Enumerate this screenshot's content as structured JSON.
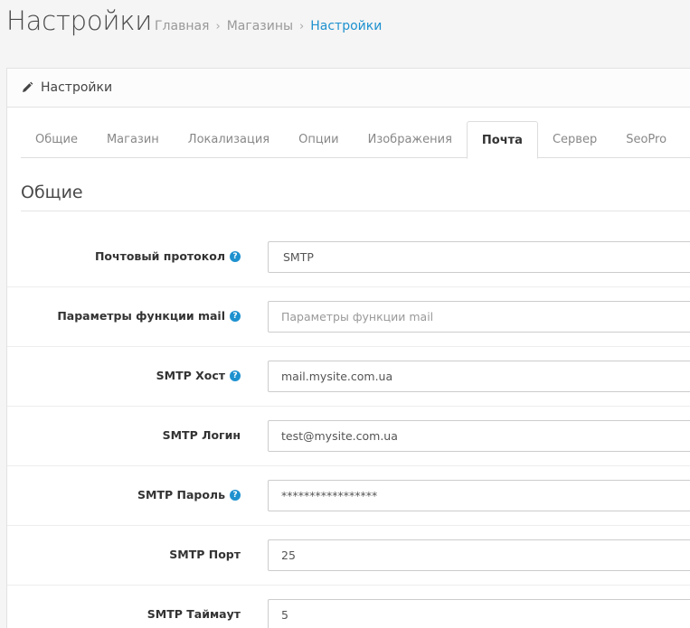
{
  "header": {
    "title": "Настройки",
    "breadcrumb": [
      {
        "label": "Главная"
      },
      {
        "label": "Магазины"
      },
      {
        "label": "Настройки"
      }
    ]
  },
  "panel": {
    "title": "Настройки",
    "icon": "pencil-icon"
  },
  "tabs": [
    {
      "label": "Общие"
    },
    {
      "label": "Магазин"
    },
    {
      "label": "Локализация"
    },
    {
      "label": "Опции"
    },
    {
      "label": "Изображения"
    },
    {
      "label": "Почта",
      "active": true
    },
    {
      "label": "Сервер"
    },
    {
      "label": "SeoPro"
    }
  ],
  "section": {
    "legend": "Общие"
  },
  "fields": {
    "protocol": {
      "label": "Почтовый протокол",
      "value": "SMTP"
    },
    "mail_params": {
      "label": "Параметры функции mail",
      "value": "",
      "placeholder": "Параметры функции mail"
    },
    "smtp_host": {
      "label": "SMTP Хост",
      "value": "mail.mysite.com.ua"
    },
    "smtp_login": {
      "label": "SMTP Логин",
      "value": "test@mysite.com.ua"
    },
    "smtp_password": {
      "label": "SMTP Пароль",
      "value": "*****************"
    },
    "smtp_port": {
      "label": "SMTP Порт",
      "value": "25"
    },
    "smtp_timeout": {
      "label": "SMTP Таймаут",
      "value": "5"
    }
  },
  "colors": {
    "accent": "#1e91cf",
    "background": "#f5f5f5"
  }
}
